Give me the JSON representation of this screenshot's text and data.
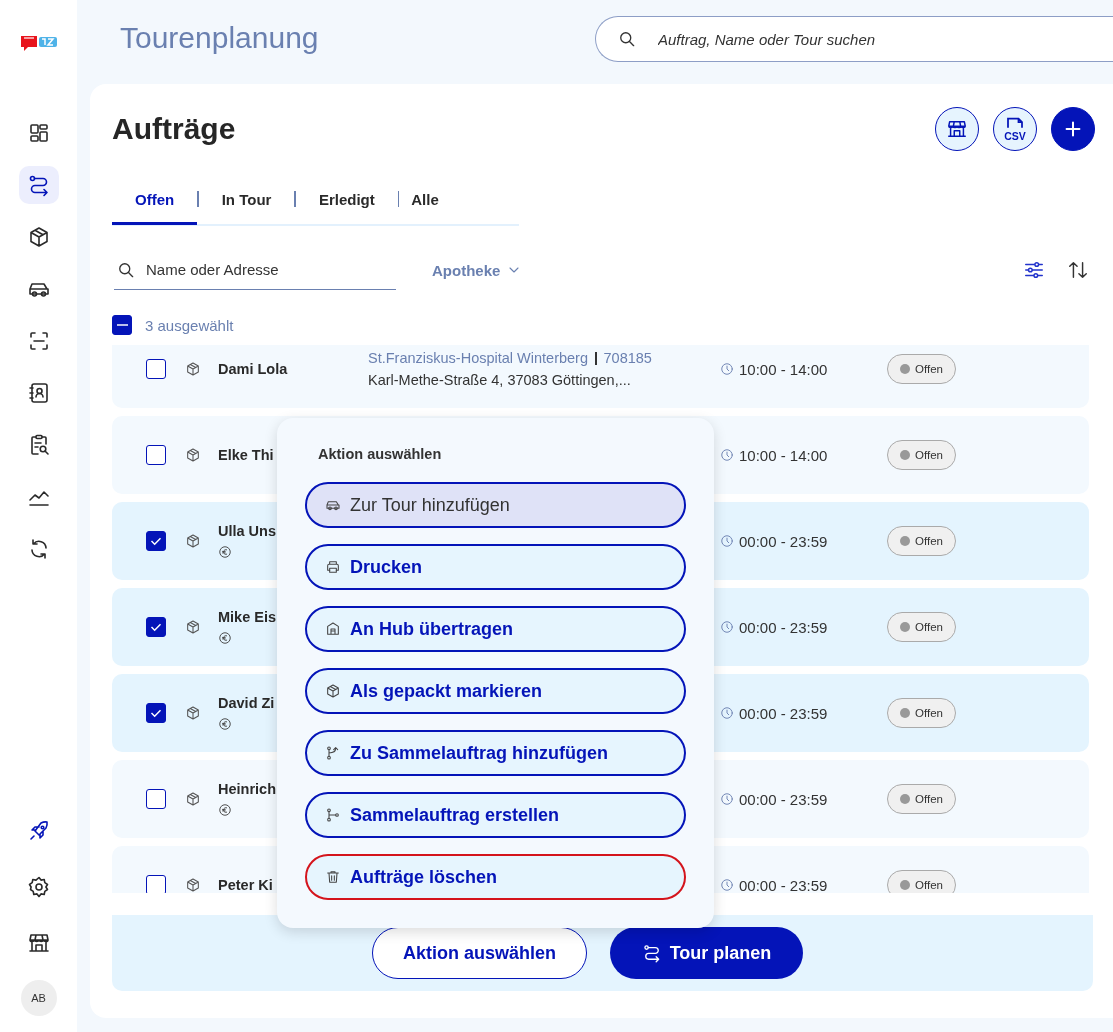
{
  "sidebar": {
    "items": [
      {
        "kind": "dashboard",
        "selected": false
      },
      {
        "kind": "route",
        "selected": true
      },
      {
        "kind": "box",
        "selected": false
      },
      {
        "kind": "car",
        "selected": false
      },
      {
        "kind": "scan",
        "selected": false
      },
      {
        "kind": "contacts",
        "selected": false
      },
      {
        "kind": "clipboard",
        "selected": false
      },
      {
        "kind": "chart",
        "selected": false
      },
      {
        "kind": "sync",
        "selected": false
      }
    ],
    "bottom_items": [
      {
        "kind": "rocket",
        "selected": false
      },
      {
        "kind": "gear",
        "selected": false
      },
      {
        "kind": "store",
        "selected": false
      }
    ],
    "avatar": "AB"
  },
  "header": {
    "title": "Tourenplanung",
    "search": {
      "placeholder": "Auftrag, Name oder Tour suchen"
    }
  },
  "page": {
    "title": "Aufträge",
    "buttons": [
      {
        "kind": "store"
      },
      {
        "kind": "csv",
        "label": "CSV"
      },
      {
        "kind": "add"
      }
    ]
  },
  "tabs": [
    {
      "label": "Offen",
      "selected": true
    },
    {
      "label": "In Tour",
      "selected": false
    },
    {
      "label": "Erledigt",
      "selected": false
    },
    {
      "label": "Alle",
      "selected": false
    }
  ],
  "filters": {
    "search": {
      "placeholder": "Name oder Adresse"
    },
    "dropdown": "Apotheke"
  },
  "selection": {
    "label": "3 ausgewählt",
    "indeterminate": true
  },
  "orders": [
    {
      "name": "Dami Lola",
      "selected": false,
      "euro": false,
      "place": "St.Franziskus-Hospital Winterberg",
      "number": "708185",
      "address": "Karl-Methe-Straße 4, 37083 Göttingen,...",
      "time": "10:00 - 14:00",
      "status": "Offen"
    },
    {
      "name": "Elke Thi",
      "selected": false,
      "euro": false,
      "time": "10:00 - 14:00",
      "status": "Offen"
    },
    {
      "name": "Ulla Uns",
      "selected": true,
      "euro": true,
      "time": "00:00 - 23:59",
      "status": "Offen"
    },
    {
      "name": "Mike Eis",
      "selected": true,
      "euro": true,
      "time": "00:00 - 23:59",
      "status": "Offen"
    },
    {
      "name": "David Zi",
      "selected": true,
      "euro": true,
      "time": "00:00 - 23:59",
      "status": "Offen"
    },
    {
      "name": "Heinrich",
      "selected": false,
      "euro": true,
      "time": "00:00 - 23:59",
      "status": "Offen"
    },
    {
      "name": "Peter Ki",
      "selected": false,
      "euro": false,
      "time": "00:00 - 23:59",
      "status": "Offen"
    }
  ],
  "action_menu": {
    "title": "Aktion auswählen",
    "actions": [
      {
        "kind": "car",
        "label": "Zur Tour hinzufügen",
        "selected": true,
        "danger": false
      },
      {
        "kind": "printer",
        "label": "Drucken",
        "selected": false,
        "danger": false
      },
      {
        "kind": "hub",
        "label": "An Hub übertragen",
        "selected": false,
        "danger": false
      },
      {
        "kind": "box",
        "label": "Als gepackt markieren",
        "selected": false,
        "danger": false
      },
      {
        "kind": "merge",
        "label": "Zu Sammelauftrag hinzufügen",
        "selected": false,
        "danger": false
      },
      {
        "kind": "branch",
        "label": "Sammelauftrag erstellen",
        "selected": false,
        "danger": false
      },
      {
        "kind": "trash",
        "label": "Aufträge löschen",
        "selected": false,
        "danger": true
      }
    ]
  },
  "footer_buttons": [
    {
      "kind": "outline",
      "label": "Aktion auswählen"
    },
    {
      "kind": "primary",
      "label": "Tour planen"
    }
  ]
}
